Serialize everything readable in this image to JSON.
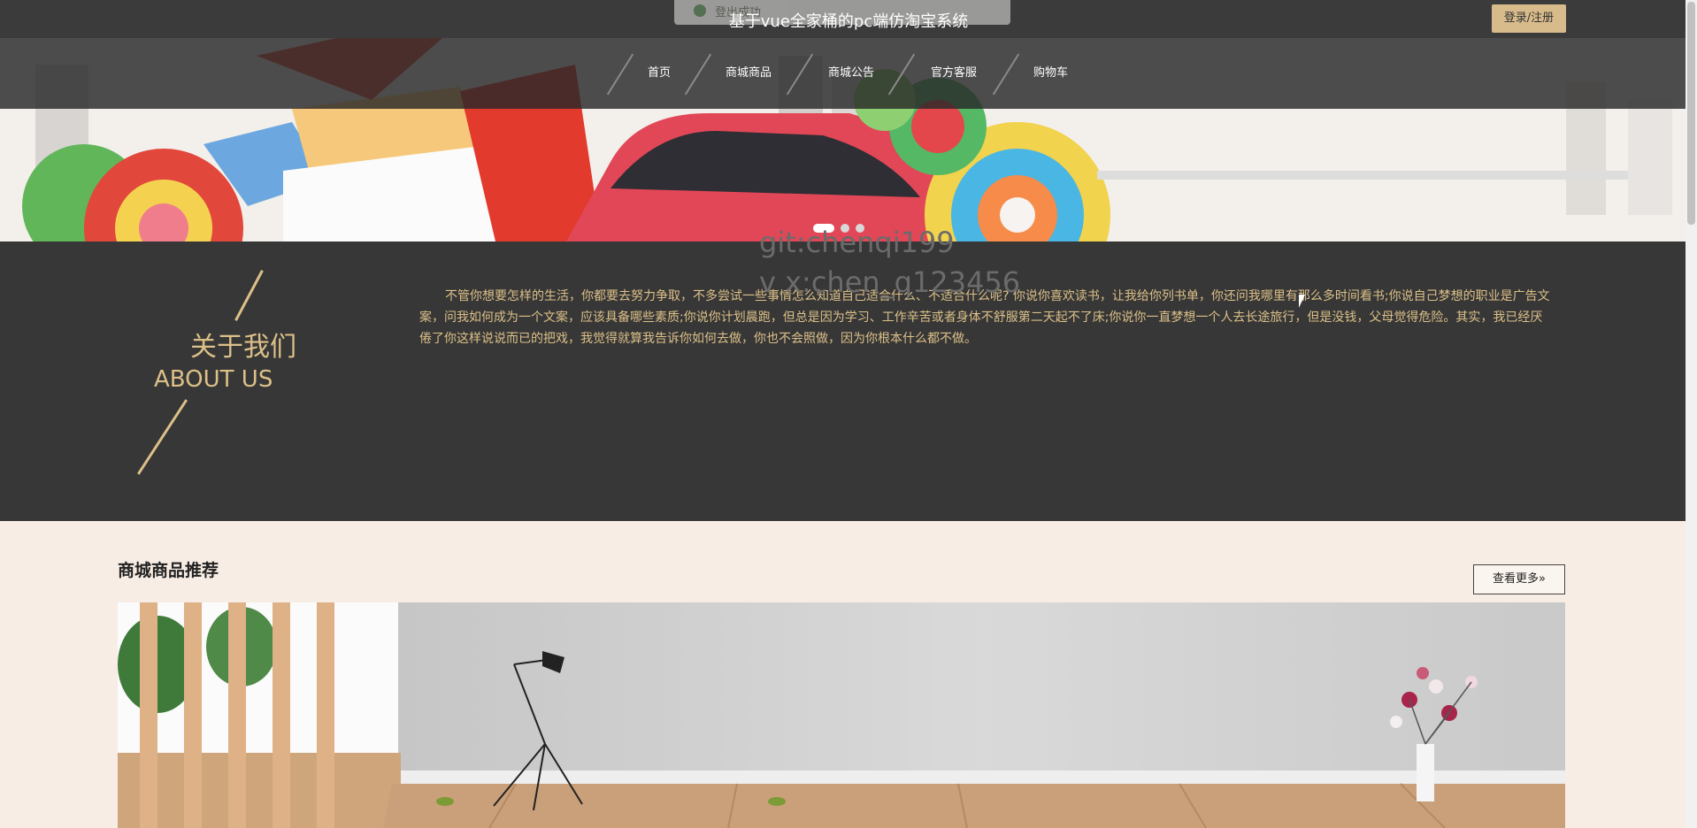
{
  "toast": {
    "text": "登出成功"
  },
  "header": {
    "title": "基于vue全家桶的pc端仿淘宝系统",
    "login_label": "登录/注册"
  },
  "nav": {
    "items": [
      "首页",
      "商城商品",
      "商城公告",
      "官方客服",
      "购物车"
    ]
  },
  "watermark": {
    "line1": "git:chenqi199",
    "line2": "v x:chen_q123456"
  },
  "about": {
    "title": "关于我们",
    "subtitle": "ABOUT US",
    "text": "不管你想要怎样的生活，你都要去努力争取，不多尝试一些事情怎么知道自己适合什么、不适合什么呢? 你说你喜欢读书，让我给你列书单，你还问我哪里有那么多时间看书;你说自己梦想的职业是广告文案，问我如何成为一个文案，应该具备哪些素质;你说你计划晨跑，但总是因为学习、工作辛苦或者身体不舒服第二天起不了床;你说你一直梦想一个人去长途旅行，但是没钱，父母觉得危险。其实，我已经厌倦了你这样说说而已的把戏，我觉得就算我告诉你如何去做，你也不会照做，因为你根本什么都不做。"
  },
  "recommend": {
    "title": "商城商品推荐",
    "more_label": "查看更多»"
  },
  "colors": {
    "accent": "#dcc088",
    "dark": "#373737",
    "page_bg": "#f7ede4",
    "button": "#d8bb8b"
  }
}
